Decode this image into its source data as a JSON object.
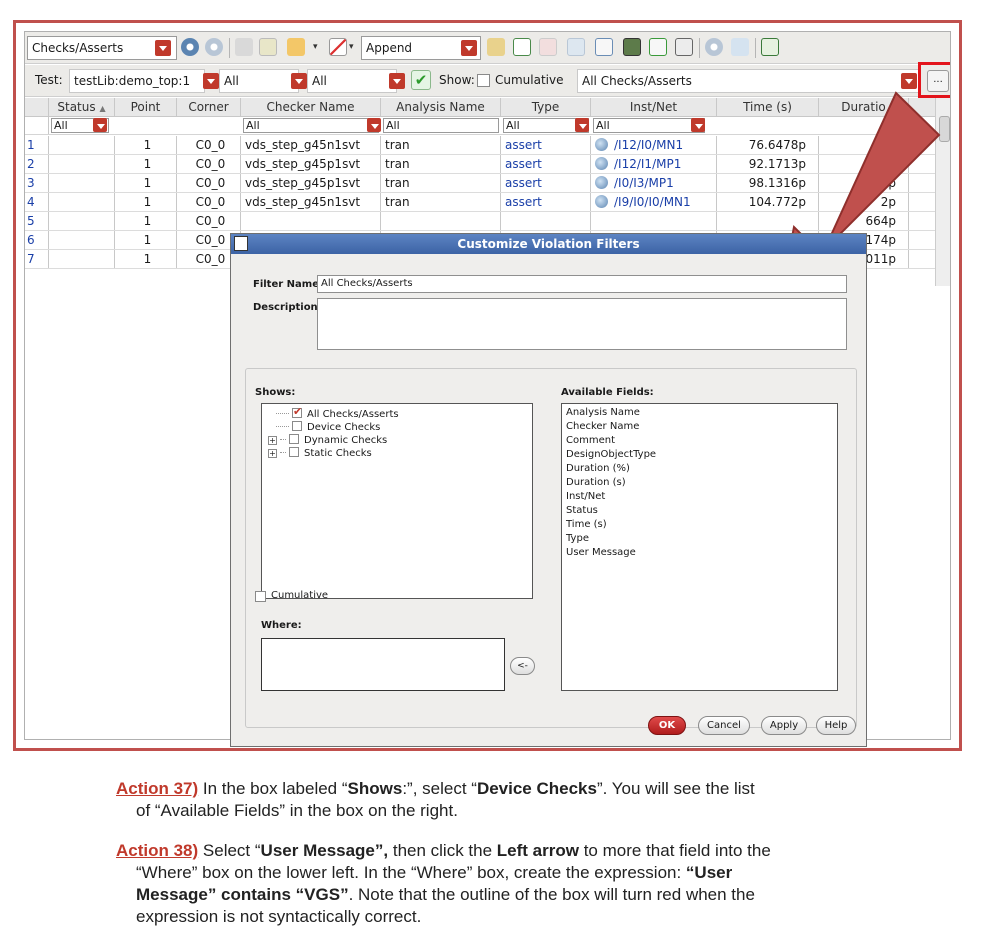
{
  "toolbar": {
    "view_select": "Checks/Asserts",
    "mode_select": "Append"
  },
  "filterbar": {
    "test_label": "Test:",
    "test_value": "testLib:demo_top:1",
    "filter1": "All",
    "filter2": "All",
    "show_label": "Show:",
    "cumulative_label": "Cumulative",
    "filter_set": "All Checks/Asserts",
    "more_label": "..."
  },
  "table": {
    "headers": [
      "Status",
      "Point",
      "Corner",
      "Checker Name",
      "Analysis Name",
      "Type",
      "Inst/Net",
      "Time (s)",
      "Duratio"
    ],
    "filters": {
      "status": "All",
      "checker": "All",
      "analysis": "All",
      "type": "All",
      "inst": "All"
    },
    "rows": [
      {
        "num": "1",
        "point": "1",
        "corner": "C0_0",
        "checker": "vds_step_g45n1svt",
        "analysis": "tran",
        "type": "assert",
        "inst": "/I12/I0/MN1",
        "time": "76.6478p",
        "dur": "3.("
      },
      {
        "num": "2",
        "point": "1",
        "corner": "C0_0",
        "checker": "vds_step_g45p1svt",
        "analysis": "tran",
        "type": "assert",
        "inst": "/I12/I1/MP1",
        "time": "92.1713p",
        "dur": ""
      },
      {
        "num": "3",
        "point": "1",
        "corner": "C0_0",
        "checker": "vds_step_g45p1svt",
        "analysis": "tran",
        "type": "assert",
        "inst": "/I0/I3/MP1",
        "time": "98.1316p",
        "dur": "p"
      },
      {
        "num": "4",
        "point": "1",
        "corner": "C0_0",
        "checker": "vds_step_g45n1svt",
        "analysis": "tran",
        "type": "assert",
        "inst": "/I9/I0/I0/MN1",
        "time": "104.772p",
        "dur": "2p"
      },
      {
        "num": "5",
        "point": "1",
        "corner": "C0_0",
        "checker": "",
        "analysis": "",
        "type": "",
        "inst": "",
        "time": "",
        "dur": "664p"
      },
      {
        "num": "6",
        "point": "1",
        "corner": "C0_0",
        "checker": "",
        "analysis": "",
        "type": "",
        "inst": "",
        "time": "",
        "dur": "174p"
      },
      {
        "num": "7",
        "point": "1",
        "corner": "C0_0",
        "checker": "",
        "analysis": "",
        "type": "",
        "inst": "",
        "time": "",
        "dur": ")011p"
      }
    ]
  },
  "dialog": {
    "title": "Customize Violation Filters",
    "filter_name_label": "Filter Name:",
    "filter_name_value": "All Checks/Asserts",
    "description_label": "Description:",
    "shows_label": "Shows:",
    "shows_items": [
      "All Checks/Asserts",
      "Device Checks",
      "Dynamic Checks",
      "Static Checks"
    ],
    "available_label": "Available Fields:",
    "available_fields": [
      "Analysis Name",
      "Checker Name",
      "Comment",
      "DesignObjectType",
      "Duration (%)",
      "Duration (s)",
      "Inst/Net",
      "Status",
      "Time (s)",
      "Type",
      "User Message"
    ],
    "cumulative_label": "Cumulative",
    "where_label": "Where:",
    "move_button": "<-",
    "ok": "OK",
    "cancel": "Cancel",
    "apply": "Apply",
    "help": "Help"
  },
  "instructions": {
    "a37_label": "Action 37)",
    "a37_t1": " In the box labeled “",
    "a37_b1": "Shows",
    "a37_t2": ":”, select “",
    "a37_b2": "Device Checks",
    "a37_t3": "”.  You will see the list",
    "a37_line2": "of “Available Fields” in the box on the right.",
    "a38_label": "Action 38)",
    "a38_t1": " Select “",
    "a38_b1": "User Message”,",
    "a38_t2": " then click the ",
    "a38_b2": "Left arrow",
    "a38_t3": " to more that field into the",
    "a38_line2_t1": "“Where” box on the lower left.  In the “Where” box, create the expression: ",
    "a38_line2_b1": "“User",
    "a38_line3_b1": "Message” contains “VGS”",
    "a38_line3_t1": ".  Note that the outline of the box will turn red when the",
    "a38_line4": "expression is not syntactically correct."
  },
  "colors": {
    "frame": "#c0504d",
    "highlight_box": "#e3141b",
    "arrow": "#c0504d",
    "action_label": "#c0392b",
    "dialog_title": "#4a70b2"
  }
}
